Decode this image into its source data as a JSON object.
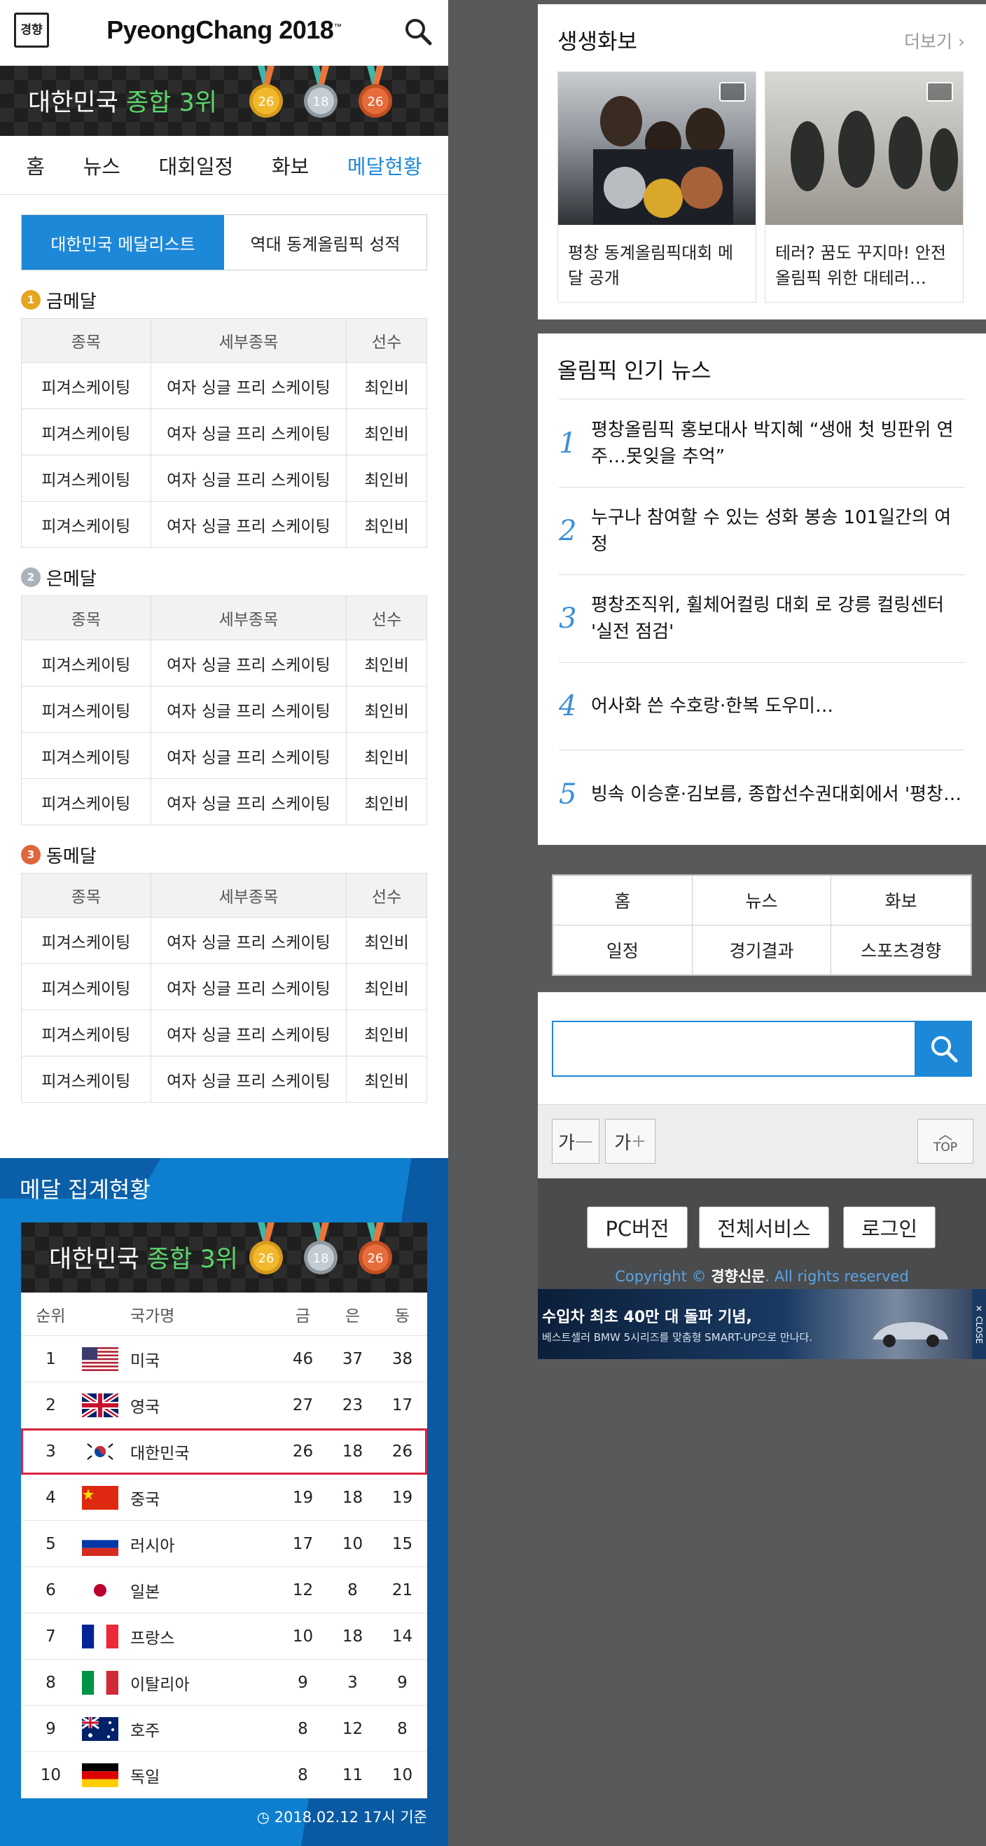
{
  "header": {
    "logo_text": "경향",
    "brand": "PyeongChang 2018",
    "brand_tm": "™"
  },
  "medal_banner": {
    "prefix": "대한민국",
    "highlight": "종합 3위",
    "gold": "26",
    "silver": "18",
    "bronze": "26"
  },
  "nav": [
    "홈",
    "뉴스",
    "대회일정",
    "화보",
    "메달현황"
  ],
  "tabs": [
    "대한민국 메달리스트",
    "역대 동계올림픽 성적"
  ],
  "medal_sections": [
    {
      "badge": "1",
      "title": "금메달",
      "color": "#e6a623",
      "headers": [
        "종목",
        "세부종목",
        "선수"
      ],
      "rows": [
        [
          "피겨스케이팅",
          "여자 싱글 프리 스케이팅",
          "최인비"
        ],
        [
          "피겨스케이팅",
          "여자 싱글 프리 스케이팅",
          "최인비"
        ],
        [
          "피겨스케이팅",
          "여자 싱글 프리 스케이팅",
          "최인비"
        ],
        [
          "피겨스케이팅",
          "여자 싱글 프리 스케이팅",
          "최인비"
        ]
      ]
    },
    {
      "badge": "2",
      "title": "은메달",
      "color": "#a9b3bb",
      "headers": [
        "종목",
        "세부종목",
        "선수"
      ],
      "rows": [
        [
          "피겨스케이팅",
          "여자 싱글 프리 스케이팅",
          "최인비"
        ],
        [
          "피겨스케이팅",
          "여자 싱글 프리 스케이팅",
          "최인비"
        ],
        [
          "피겨스케이팅",
          "여자 싱글 프리 스케이팅",
          "최인비"
        ],
        [
          "피겨스케이팅",
          "여자 싱글 프리 스케이팅",
          "최인비"
        ]
      ]
    },
    {
      "badge": "3",
      "title": "동메달",
      "color": "#e0663c",
      "headers": [
        "종목",
        "세부종목",
        "선수"
      ],
      "rows": [
        [
          "피겨스케이팅",
          "여자 싱글 프리 스케이팅",
          "최인비"
        ],
        [
          "피겨스케이팅",
          "여자 싱글 프리 스케이팅",
          "최인비"
        ],
        [
          "피겨스케이팅",
          "여자 싱글 프리 스케이팅",
          "최인비"
        ],
        [
          "피겨스케이팅",
          "여자 싱글 프리 스케이팅",
          "최인비"
        ]
      ]
    }
  ],
  "tally": {
    "title": "메달 집계현황",
    "headers": {
      "rank": "순위",
      "country": "국가명",
      "gold": "금",
      "silver": "은",
      "bronze": "동"
    },
    "rows": [
      {
        "rank": "1",
        "flag": "us",
        "country": "미국",
        "g": "46",
        "s": "37",
        "b": "38"
      },
      {
        "rank": "2",
        "flag": "uk",
        "country": "영국",
        "g": "27",
        "s": "23",
        "b": "17"
      },
      {
        "rank": "3",
        "flag": "kr",
        "country": "대한민국",
        "g": "26",
        "s": "18",
        "b": "26",
        "highlight": true
      },
      {
        "rank": "4",
        "flag": "cn",
        "country": "중국",
        "g": "19",
        "s": "18",
        "b": "19"
      },
      {
        "rank": "5",
        "flag": "ru",
        "country": "러시아",
        "g": "17",
        "s": "10",
        "b": "15"
      },
      {
        "rank": "6",
        "flag": "jp",
        "country": "일본",
        "g": "12",
        "s": "8",
        "b": "21"
      },
      {
        "rank": "7",
        "flag": "fr",
        "country": "프랑스",
        "g": "10",
        "s": "18",
        "b": "14"
      },
      {
        "rank": "8",
        "flag": "it",
        "country": "이탈리아",
        "g": "9",
        "s": "3",
        "b": "9"
      },
      {
        "rank": "9",
        "flag": "au",
        "country": "호주",
        "g": "8",
        "s": "12",
        "b": "8"
      },
      {
        "rank": "10",
        "flag": "de",
        "country": "독일",
        "g": "8",
        "s": "11",
        "b": "10"
      }
    ],
    "timestamp": "2018.02.12 17시 기준"
  },
  "photos": {
    "title": "생생화보",
    "more": "더보기",
    "items": [
      {
        "caption": "평창 동계올림픽대회 메달 공개"
      },
      {
        "caption": "테러? 꿈도 꾸지마! 안전 올림픽 위한 대테러…"
      }
    ]
  },
  "popular": {
    "title": "올림픽 인기 뉴스",
    "items": [
      {
        "num": "1",
        "title": "평창올림픽 홍보대사 박지혜 “생애 첫 빙판위 연주…못잊을 추억”"
      },
      {
        "num": "2",
        "title": "누구나 참여할 수 있는 성화 봉송 101일간의 여정"
      },
      {
        "num": "3",
        "title": "평창조직위, 휠체어컬링 대회 로 강릉 컬링센터 '실전 점검'"
      },
      {
        "num": "4",
        "title": "어사화 쓴 수호랑·한복 도우미…"
      },
      {
        "num": "5",
        "title": "빙속 이승훈·김보름, 종합선수권대회에서 '평창…"
      }
    ]
  },
  "footer_nav": [
    "홈",
    "뉴스",
    "화보",
    "일정",
    "경기결과",
    "스포츠경향"
  ],
  "search": {
    "value": "",
    "placeholder": ""
  },
  "font_controls": {
    "decrease": "가",
    "increase": "가",
    "top": "TOP"
  },
  "footer": {
    "pc": "PC버전",
    "all": "전체서비스",
    "login": "로그인",
    "copyright_pre": "Copyright ©",
    "company": "경향신문",
    "copyright_post": ". All rights reserved"
  },
  "ad": {
    "headline": "수입차 최초 40만 대 돌파 기념,",
    "sub": "베스트셀러 BMW 5시리즈를 맞춤형 SMART-UP으로 만나다.",
    "close": "CLOSE"
  },
  "colors": {
    "accent": "#1e88d8",
    "highlight_green": "#5bd66a",
    "highlight_row": "#d9253f"
  }
}
